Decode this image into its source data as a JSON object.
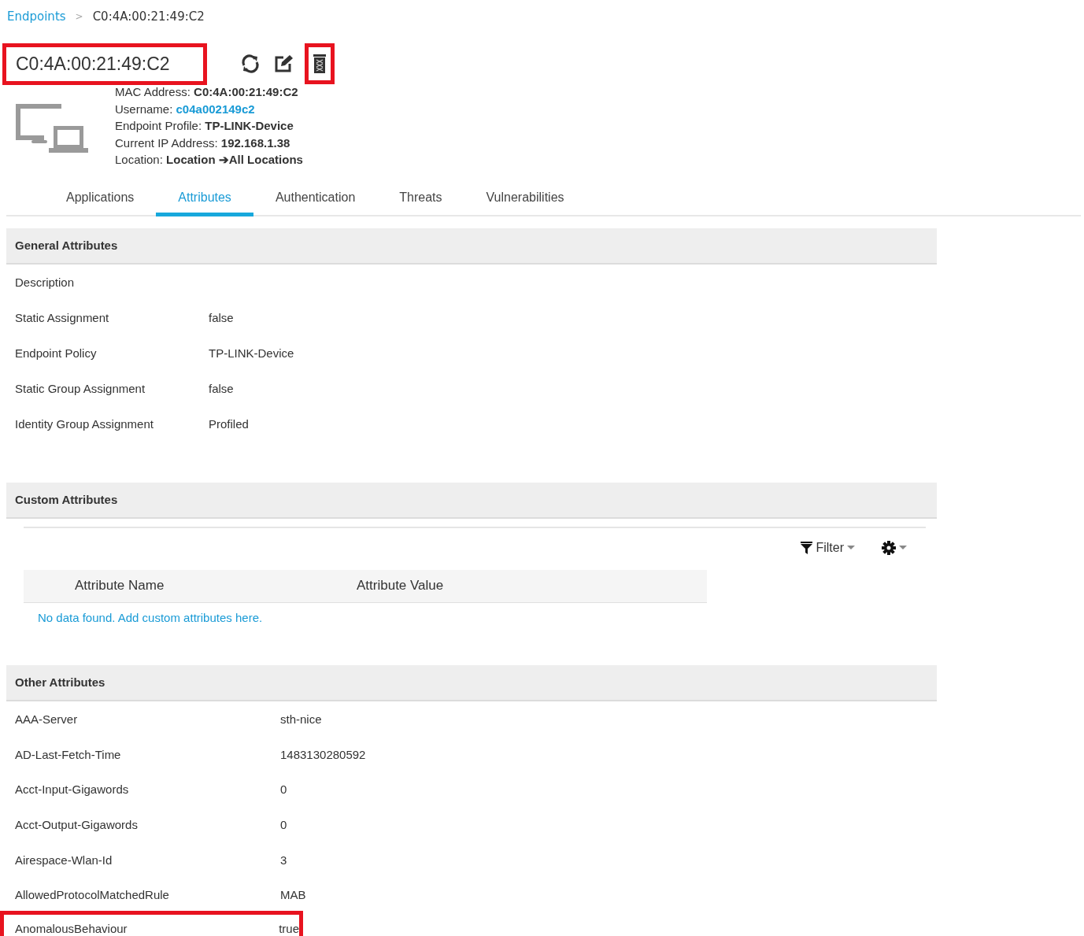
{
  "breadcrumb": {
    "link": "Endpoints",
    "separator": ">",
    "current": "C0:4A:00:21:49:C2"
  },
  "header": {
    "title": "C0:4A:00:21:49:C2",
    "title_highlighted": true,
    "delete_highlighted": true
  },
  "info": [
    {
      "label": "MAC Address:",
      "value": "C0:4A:00:21:49:C2",
      "kind": "bold"
    },
    {
      "label": "Username:",
      "value": "c04a002149c2",
      "kind": "link"
    },
    {
      "label": "Endpoint Profile:",
      "value": "TP-LINK-Device",
      "kind": "bold"
    },
    {
      "label": "Current IP Address:",
      "value": "192.168.1.38",
      "kind": "bold"
    },
    {
      "label": "Location:",
      "value": "Location ➔All Locations",
      "kind": "bold"
    }
  ],
  "tabs": [
    {
      "label": "Applications",
      "selected": false
    },
    {
      "label": "Attributes",
      "selected": true
    },
    {
      "label": "Authentication",
      "selected": false
    },
    {
      "label": "Threats",
      "selected": false
    },
    {
      "label": "Vulnerabilities",
      "selected": false
    }
  ],
  "general_attributes": {
    "title": "General Attributes",
    "rows": [
      {
        "name": "Description"
      },
      {
        "name": "Static Assignment",
        "value": "false"
      },
      {
        "name": "Endpoint Policy",
        "value": "TP-LINK-Device"
      },
      {
        "name": "Static Group Assignment",
        "value": "false"
      },
      {
        "name": "Identity Group Assignment",
        "value": "Profiled"
      }
    ]
  },
  "custom_attributes": {
    "title": "Custom Attributes",
    "filter": "Filter",
    "columns": [
      "Attribute Name",
      "Attribute Value"
    ],
    "empty_message": "No data found. Add custom attributes here."
  },
  "other_attributes": {
    "title": "Other Attributes",
    "rows": [
      {
        "name": "AAA-Server",
        "value": "sth-nice",
        "highlighted": false
      },
      {
        "name": "AD-Last-Fetch-Time",
        "value": "1483130280592",
        "highlighted": false
      },
      {
        "name": "Acct-Input-Gigawords",
        "value": "0",
        "highlighted": false
      },
      {
        "name": "Acct-Output-Gigawords",
        "value": "0",
        "highlighted": false
      },
      {
        "name": "Airespace-Wlan-Id",
        "value": "3",
        "highlighted": false
      },
      {
        "name": "AllowedProtocolMatchedRule",
        "value": "MAB",
        "highlighted": false
      },
      {
        "name": "AnomalousBehaviour",
        "value": "true",
        "highlighted": true
      }
    ]
  }
}
